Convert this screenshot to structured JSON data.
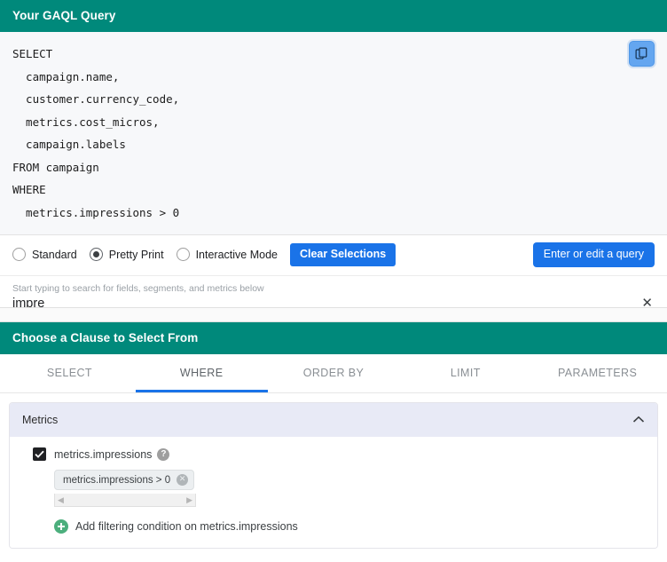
{
  "query_panel": {
    "title": "Your GAQL Query",
    "copy_icon": "copy-icon",
    "code_lines": [
      "SELECT",
      "  campaign.name,",
      "  customer.currency_code,",
      "  metrics.cost_micros,",
      "  campaign.labels",
      "FROM campaign",
      "WHERE",
      "  metrics.impressions > 0"
    ],
    "options": {
      "radios": [
        {
          "label": "Standard",
          "selected": false
        },
        {
          "label": "Pretty Print",
          "selected": true
        },
        {
          "label": "Interactive Mode",
          "selected": false
        }
      ],
      "clear_selections_label": "Clear Selections",
      "enter_edit_label": "Enter or edit a query"
    },
    "search": {
      "hint": "Start typing to search for fields, segments, and metrics below",
      "value": "impre",
      "placeholder": "",
      "clear_icon": "✕"
    }
  },
  "clause_panel": {
    "title": "Choose a Clause to Select From",
    "tabs": [
      {
        "label": "SELECT",
        "active": false
      },
      {
        "label": "WHERE",
        "active": true
      },
      {
        "label": "ORDER BY",
        "active": false
      },
      {
        "label": "LIMIT",
        "active": false
      },
      {
        "label": "PARAMETERS",
        "active": false
      }
    ],
    "group": {
      "title": "Metrics",
      "collapse_icon": "⌃",
      "field": {
        "label": "metrics.impressions",
        "checked": true,
        "check_glyph": "✔",
        "help_glyph": "?"
      },
      "chip": {
        "text": "metrics.impressions > 0",
        "remove_glyph": "✕"
      },
      "scrollbar": {
        "left_arrow": "◀",
        "right_arrow": "▶"
      },
      "add_condition_label": "Add filtering condition on metrics.impressions"
    }
  },
  "colors": {
    "teal_header": "#00897b",
    "accent_blue": "#1a73e8",
    "copy_button": "#64a6f0",
    "group_header": "#e8eaf6",
    "plus_green": "#4caf7d"
  }
}
